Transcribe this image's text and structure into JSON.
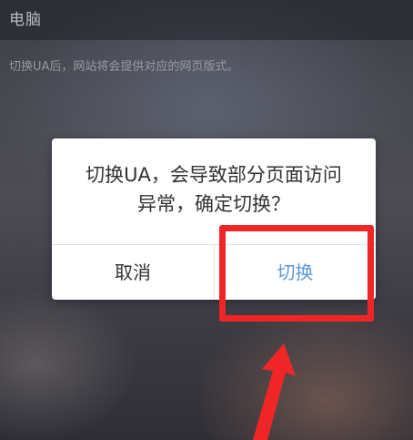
{
  "header": {
    "title": "电脑"
  },
  "description": "切换UA后，网站将会提供对应的网页版式。",
  "dialog": {
    "message_line1": "切换UA，会导致部分页面访问",
    "message_line2": "异常，确定切换？",
    "cancel_label": "取消",
    "confirm_label": "切换"
  },
  "annotation": {
    "highlight_color": "#f02626",
    "target": "confirm-button",
    "pointer_icon": "arrow-up-icon"
  },
  "colors": {
    "confirm_text": "#5b9bd5",
    "dialog_text": "#333333"
  }
}
